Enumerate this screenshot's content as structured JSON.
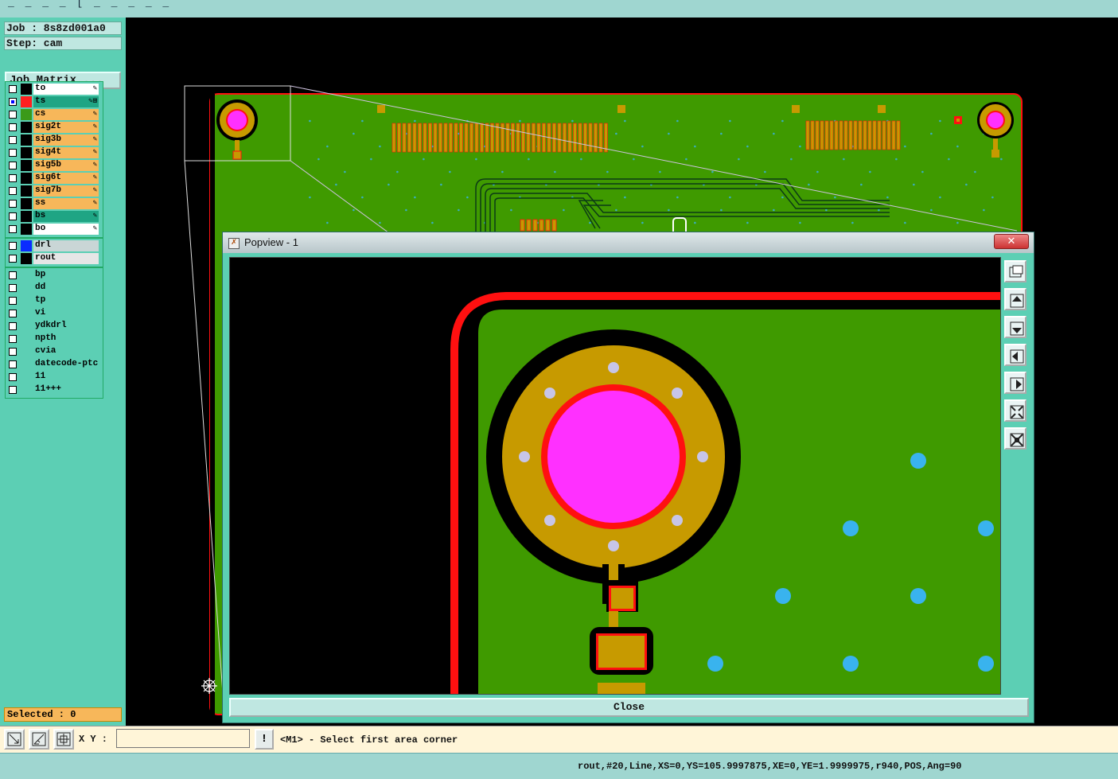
{
  "window": {
    "title_fragment": "_   _   _   _   [   _   _   _  _   _"
  },
  "job": {
    "job_line": "Job : 8s8zd001a0",
    "step_line": "Step: cam"
  },
  "matrix": {
    "label": "Job Matrix ..."
  },
  "layers": {
    "board": [
      {
        "name": "to",
        "color": "#ffffff",
        "swatch": "#000000",
        "checked": false
      },
      {
        "name": "ts",
        "color": "#1fa584",
        "swatch": "#ff2020",
        "checked": true
      },
      {
        "name": "cs",
        "color": "#f7b75a",
        "swatch": "#3b9a1a",
        "checked": false
      },
      {
        "name": "sig2t",
        "color": "#f7b75a",
        "swatch": "#000000",
        "checked": false
      },
      {
        "name": "sig3b",
        "color": "#f7b75a",
        "swatch": "#000000",
        "checked": false
      },
      {
        "name": "sig4t",
        "color": "#f7b75a",
        "swatch": "#000000",
        "checked": false
      },
      {
        "name": "sig5b",
        "color": "#f7b75a",
        "swatch": "#000000",
        "checked": false
      },
      {
        "name": "sig6t",
        "color": "#f7b75a",
        "swatch": "#000000",
        "checked": false
      },
      {
        "name": "sig7b",
        "color": "#f7b75a",
        "swatch": "#000000",
        "checked": false
      },
      {
        "name": "ss",
        "color": "#f7b75a",
        "swatch": "#000000",
        "checked": false
      },
      {
        "name": "bs",
        "color": "#1fa584",
        "swatch": "#000000",
        "checked": false
      },
      {
        "name": "bo",
        "color": "#ffffff",
        "swatch": "#000000",
        "checked": false
      }
    ],
    "drill": [
      {
        "name": "drl",
        "color": "#c9d6d6",
        "swatch": "#0a2cff",
        "checked": false
      },
      {
        "name": "rout",
        "color": "#e6e6e6",
        "swatch": "#000000",
        "checked": false
      }
    ],
    "misc": [
      {
        "name": "bp"
      },
      {
        "name": "dd"
      },
      {
        "name": "tp"
      },
      {
        "name": "vi"
      },
      {
        "name": "ydkdrl"
      },
      {
        "name": "npth"
      },
      {
        "name": "cvia"
      },
      {
        "name": "datecode-ptc"
      },
      {
        "name": "11"
      },
      {
        "name": "11+++"
      }
    ]
  },
  "selected": {
    "label": "Selected : 0"
  },
  "popview": {
    "title": "Popview - 1",
    "close_x": "✕",
    "close_button": "Close"
  },
  "toolbar_icons": [
    "popview-zoom-fit-icon",
    "pan-up-icon",
    "pan-down-icon",
    "pan-left-icon",
    "pan-right-icon",
    "zoom-in-icon",
    "zoom-out-icon"
  ],
  "command": {
    "xy_label": "X Y :",
    "xy_value": "",
    "excl": "!",
    "prompt": "<M1> - Select first area corner"
  },
  "status": {
    "text": "rout,#20,Line,XS=0,YS=105.9997875,XE=0,YE=1.9999975,r940,POS,Ang=90"
  },
  "colors": {
    "board_green": "#3f9a00",
    "outline_red": "#ff1010",
    "copper": "#c79a00",
    "pad_magenta": "#ff30ff",
    "via_blue": "#39b3ee",
    "panel_teal": "#5ccfb4"
  }
}
